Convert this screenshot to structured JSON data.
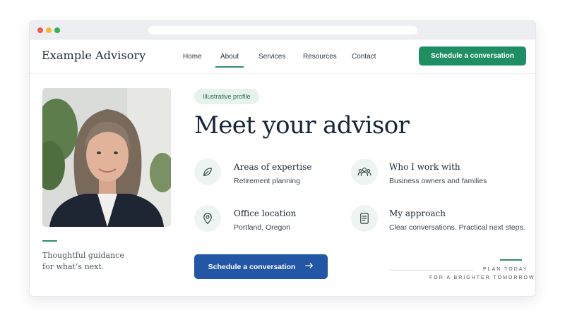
{
  "nav": {
    "brand": "Example Advisory",
    "links": [
      {
        "label": "Home"
      },
      {
        "label": "About"
      },
      {
        "label": "Services"
      },
      {
        "label": "Resources"
      },
      {
        "label": "Contact"
      }
    ],
    "active_link": "About",
    "cta_label": "Schedule a conversation"
  },
  "profile": {
    "tagline_line1": "Thoughtful guidance",
    "tagline_line2": "for what’s next."
  },
  "hero": {
    "badge": "Illustrative profile",
    "headline": "Meet your advisor"
  },
  "features": [
    {
      "icon": "leaf-icon",
      "title": "Areas of expertise",
      "desc": "Retirement planning"
    },
    {
      "icon": "people-icon",
      "title": "Who I work with",
      "desc": "Business owners and families"
    },
    {
      "icon": "location-pin-icon",
      "title": "Office location",
      "desc": "Portland, Oregon"
    },
    {
      "icon": "document-icon",
      "title": "My approach",
      "desc": "Clear conversations. Practical next steps."
    }
  ],
  "cta": {
    "label": "Schedule a conversation",
    "icon": "arrow-right-icon"
  },
  "plan": {
    "line1": "PLAN TODAY",
    "line2": "FOR A BRIGHTER TOMORROW"
  },
  "colors": {
    "accent_green": "#1f8f63",
    "primary_blue": "#2357a6",
    "heading_navy": "#152638",
    "badge_bg": "#e6f3ec"
  }
}
